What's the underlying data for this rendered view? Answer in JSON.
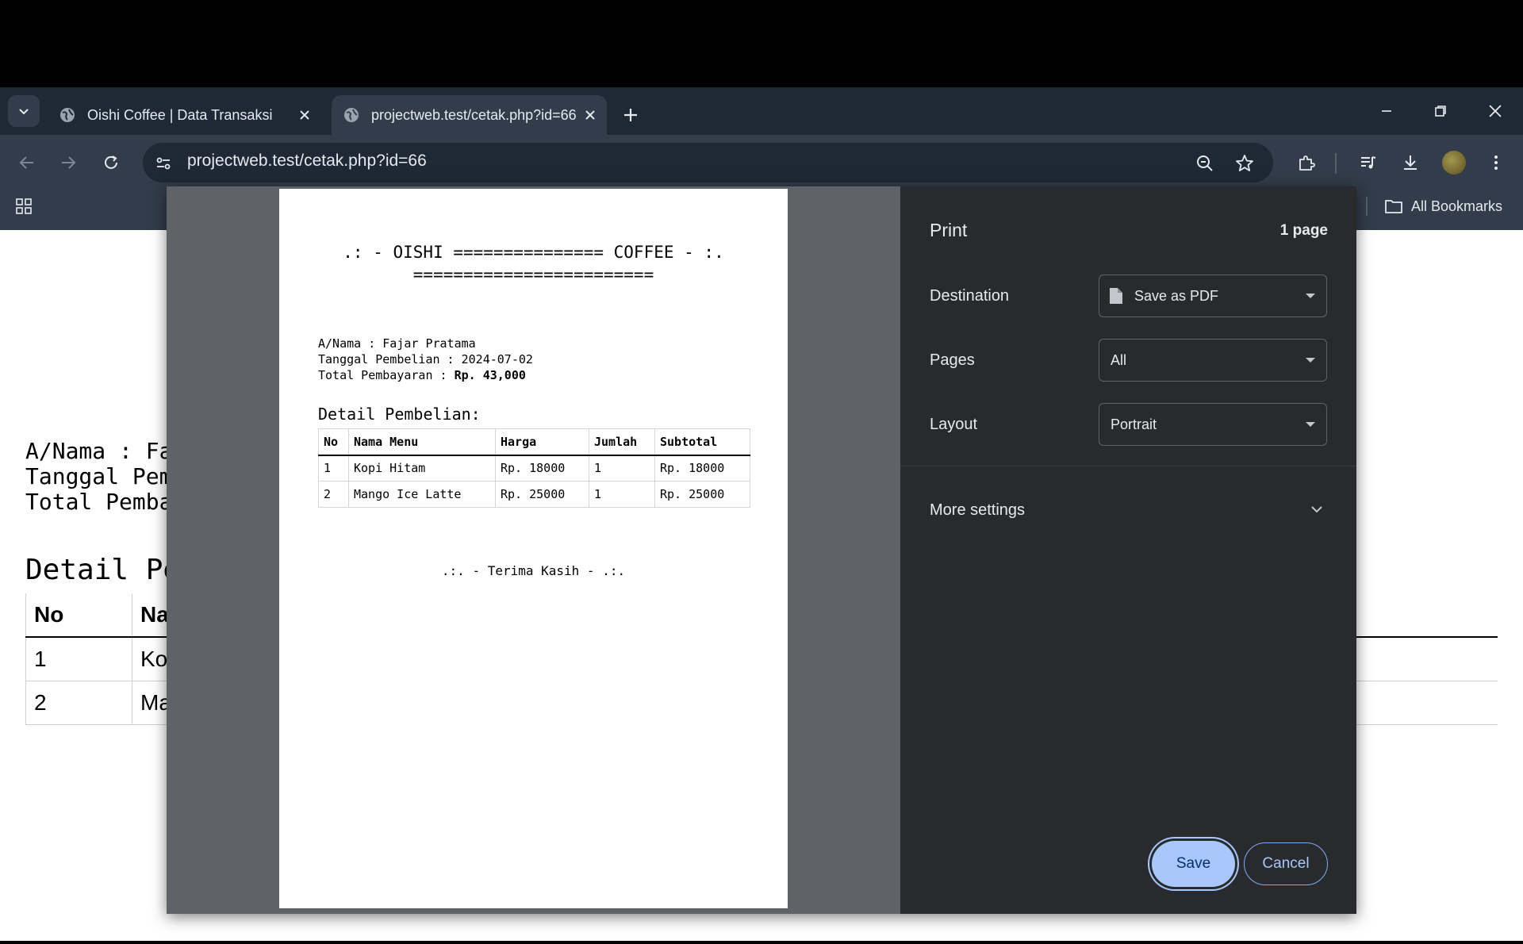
{
  "browser": {
    "tabs": [
      {
        "title": "Oishi Coffee | Data Transaksi",
        "active": false
      },
      {
        "title": "projectweb.test/cetak.php?id=66",
        "active": true
      }
    ],
    "url": "projectweb.test/cetak.php?id=66",
    "bookmarks_label": "All Bookmarks"
  },
  "background_page": {
    "nama": "A/Nama : Fa",
    "tanggal": "Tanggal Pemb",
    "total": "Total Pembay",
    "detail_heading": "Detail Pe",
    "table_headers": [
      "No",
      "Na"
    ],
    "rows": [
      [
        "1",
        "Ko"
      ],
      [
        "2",
        "Ma"
      ]
    ]
  },
  "receipt": {
    "title_line1": ".: - OISHI =============== COFFEE - :.",
    "title_line2": "========================",
    "nama": "A/Nama : Fajar Pratama",
    "tanggal": "Tanggal Pembelian : 2024-07-02",
    "total_label": "Total Pembayaran : ",
    "total_value": "Rp. 43,000",
    "detail_heading": "Detail Pembelian:",
    "headers": [
      "No",
      "Nama Menu",
      "Harga",
      "Jumlah",
      "Subtotal"
    ],
    "items": [
      [
        "1",
        "Kopi Hitam",
        "Rp. 18000",
        "1",
        "Rp. 18000"
      ],
      [
        "2",
        "Mango Ice Latte",
        "Rp. 25000",
        "1",
        "Rp. 25000"
      ]
    ],
    "footer": ".:. - Terima Kasih - .:."
  },
  "print_dialog": {
    "title": "Print",
    "page_count": "1 page",
    "destination_label": "Destination",
    "destination_value": "Save as PDF",
    "pages_label": "Pages",
    "pages_value": "All",
    "layout_label": "Layout",
    "layout_value": "Portrait",
    "more_settings": "More settings",
    "save_label": "Save",
    "cancel_label": "Cancel"
  }
}
